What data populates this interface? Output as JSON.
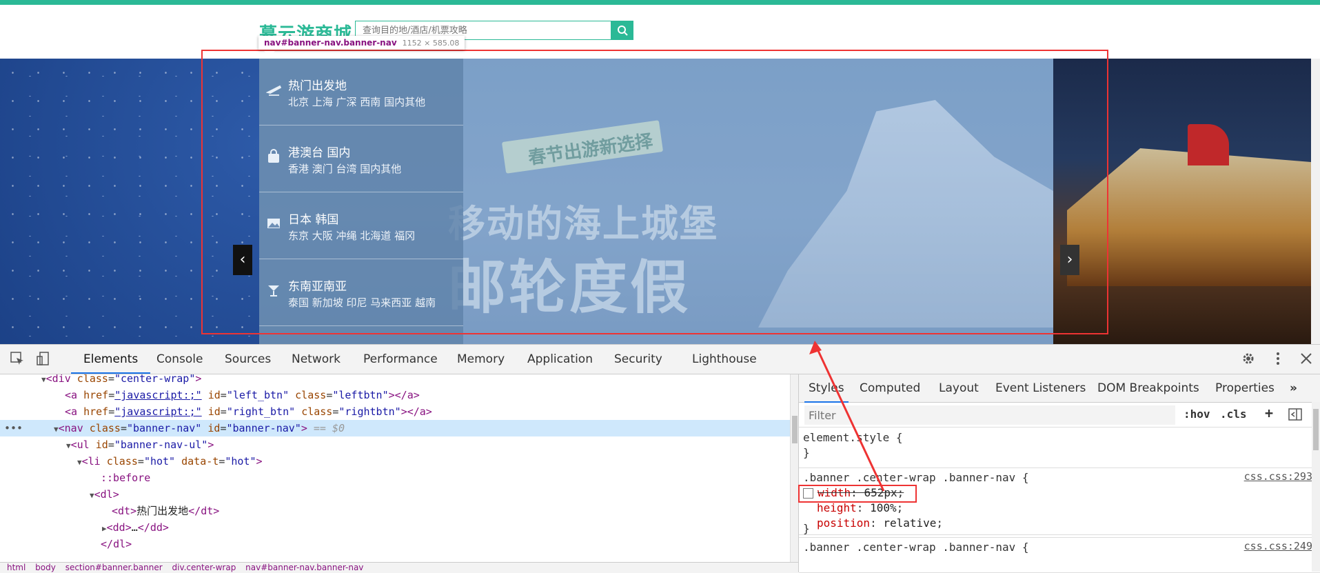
{
  "header": {
    "logo": "慕云游商城",
    "search_placeholder": "查询目的地/酒店/机票攻略"
  },
  "inspect_tooltip": {
    "tag": "nav#banner-nav.banner-nav",
    "dims": "1152 × 585.08"
  },
  "banner": {
    "ribbon_text": "春节出游新选择",
    "slogan_line1": "移动的海上城堡",
    "slogan_line2": "邮轮度假",
    "left_arrow": "‹",
    "right_arrow": "›",
    "nav_items": [
      {
        "title": "热门出发地",
        "sub": "北京 上海 广深 西南 国内其他",
        "icon": "plane-icon"
      },
      {
        "title": "港澳台 国内",
        "sub": "香港 澳门 台湾 国内其他",
        "icon": "bag-icon"
      },
      {
        "title": "日本 韩国",
        "sub": "东京 大阪 冲绳 北海道 福冈",
        "icon": "image-icon"
      },
      {
        "title": "东南亚南亚",
        "sub": "泰国 新加坡 印尼 马来西亚 越南",
        "icon": "cocktail-icon"
      }
    ]
  },
  "devtools": {
    "tabs": [
      "Elements",
      "Console",
      "Sources",
      "Network",
      "Performance",
      "Memory",
      "Application",
      "Security",
      "Lighthouse"
    ],
    "active_tab": "Elements",
    "elements": {
      "l0_tag": "div",
      "l0_attr": "class",
      "l0_val": "\"center-wrap\"",
      "l1_attr1": "href",
      "l1_val1": "\"javascript:;\"",
      "l1_attr2": "id",
      "l1_val2": "\"left_btn\"",
      "l1_attr3": "class",
      "l1_val3": "\"leftbtn\"",
      "l2_attr1": "href",
      "l2_val1": "\"javascript:;\"",
      "l2_attr2": "id",
      "l2_val2": "\"right_btn\"",
      "l2_attr3": "class",
      "l2_val3": "\"rightbtn\"",
      "l3_tag": "nav",
      "l3_attr1": "class",
      "l3_val1": "\"banner-nav\"",
      "l3_attr2": "id",
      "l3_val2": "\"banner-nav\"",
      "l3_suffix": "== $0",
      "l4_tag": "ul",
      "l4_attr": "id",
      "l4_val": "\"banner-nav-ul\"",
      "l5_tag": "li",
      "l5_attr1": "class",
      "l5_val1": "\"hot\"",
      "l5_attr2": "data-t",
      "l5_val2": "\"hot\"",
      "l6_pseudo": "::before",
      "l7_tag": "dl",
      "l8_text": "热门出发地",
      "l9_text": "…",
      "l10_tag": "dl"
    },
    "breadcrumbs": [
      "html",
      "body",
      "section#banner.banner",
      "div.center-wrap",
      "nav#banner-nav.banner-nav"
    ],
    "styles": {
      "tabs": [
        "Styles",
        "Computed",
        "Layout",
        "Event Listeners",
        "DOM Breakpoints",
        "Properties"
      ],
      "more": "»",
      "filter_placeholder": "Filter",
      "hov": ":hov",
      "cls": ".cls",
      "plus": "+",
      "rule0_selector": "element.style {",
      "close_brace": "}",
      "rule1_selector": ".banner .center-wrap .banner-nav {",
      "rule1_source": "css.css:293",
      "rule1_p1_name": "width",
      "rule1_p1_val": "652px",
      "rule1_p2_name": "height",
      "rule1_p2_val": "100%",
      "rule1_p3_name": "position",
      "rule1_p3_val": "relative",
      "rule2_selector": ".banner .center-wrap .banner-nav {",
      "rule2_source": "css.css:249"
    }
  },
  "colors": {
    "brand": "#2bb996",
    "highlight_red": "#e33333",
    "devtools_blue": "#1a73e8"
  }
}
